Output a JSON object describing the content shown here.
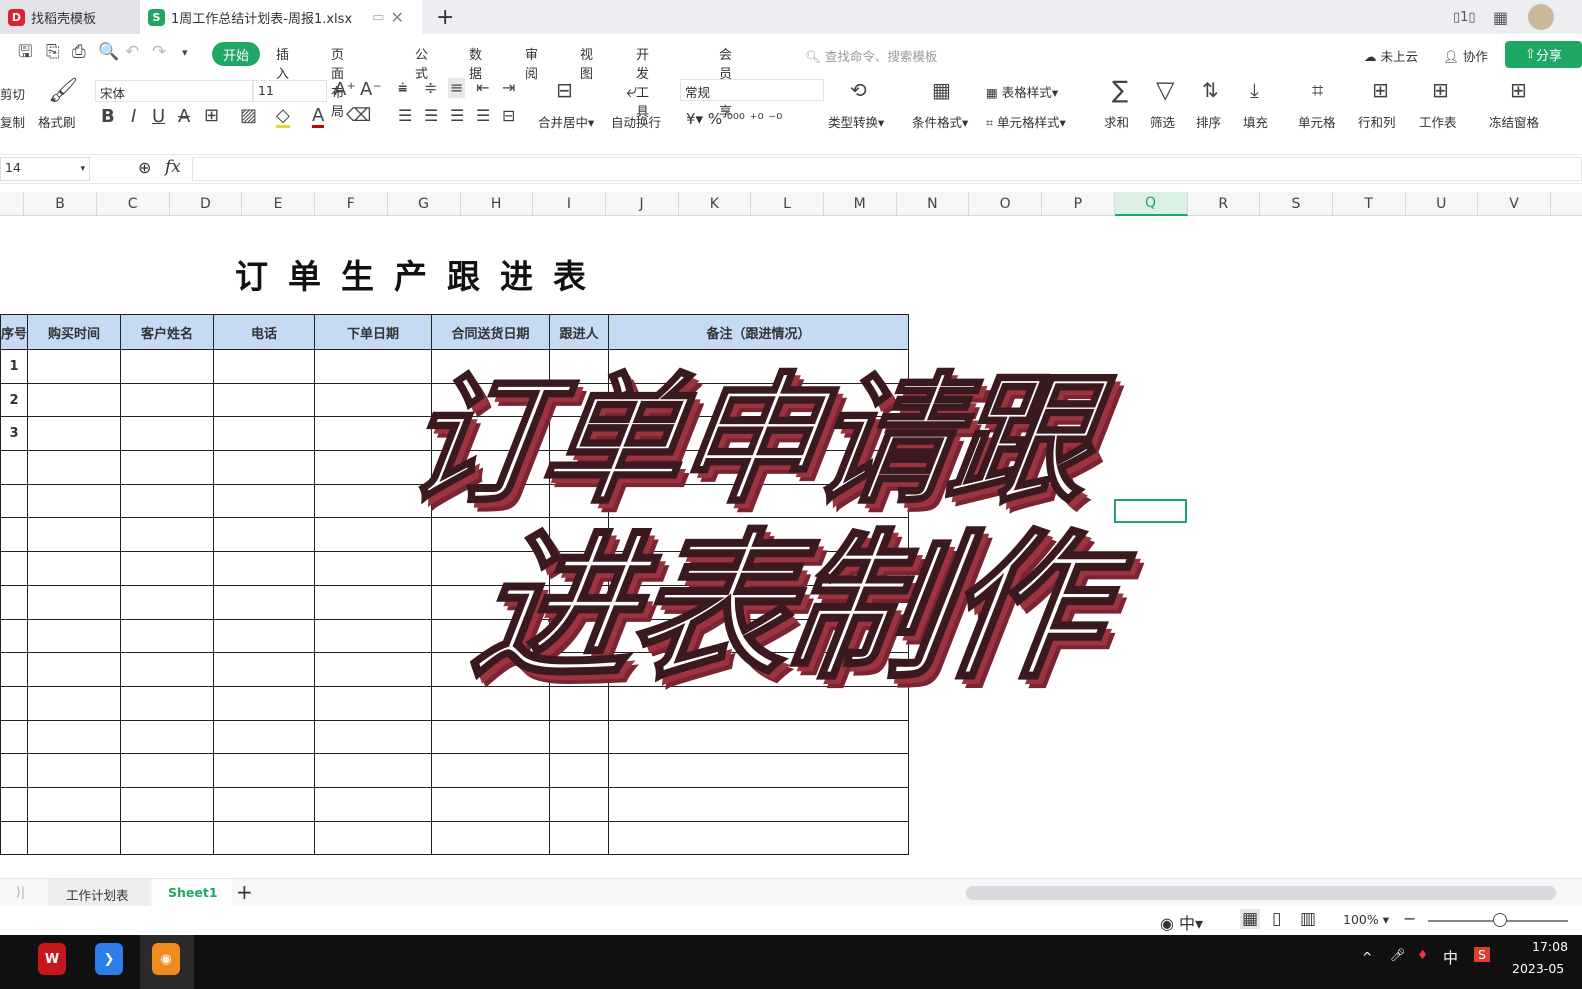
{
  "tabs": [
    {
      "label": "找稻壳模板",
      "icon": "docer-logo-icon",
      "color": "#d9232d"
    },
    {
      "label": "1周工作总结计划表-周报1.xlsx",
      "icon": "spreadsheet-logo-icon",
      "color": "#1fa865"
    }
  ],
  "menu": {
    "items": [
      "插入",
      "页面布局",
      "公式",
      "数据",
      "审阅",
      "视图",
      "开发工具",
      "会员专享"
    ],
    "active": "开始",
    "search_placeholder": "查找命令、搜索模板",
    "cloud": "未上云",
    "collab": "协作",
    "share": "分享"
  },
  "toolbar": {
    "cut": "剪切",
    "copy": "复制",
    "format_painter": "格式刷",
    "font": "宋体",
    "size": "11",
    "number_format": "常规",
    "merge": "合并居中",
    "wrap": "自动换行",
    "convert": "类型转换",
    "cond": "条件格式",
    "table_style": "表格样式",
    "cell_style": "单元格样式",
    "sum": "求和",
    "filter": "筛选",
    "sort": "排序",
    "fill": "填充",
    "cell": "单元格",
    "rowcol": "行和列",
    "sheet": "工作表",
    "freeze": "冻结窗格"
  },
  "formula": {
    "cell_ref": "14",
    "fx": "fx",
    "value": ""
  },
  "columns": [
    "B",
    "C",
    "D",
    "E",
    "F",
    "G",
    "H",
    "I",
    "J",
    "K",
    "L",
    "M",
    "N",
    "O",
    "P",
    "Q",
    "R",
    "S",
    "T",
    "U",
    "V"
  ],
  "selected_column": "Q",
  "sheet": {
    "title": "订单生产跟进表",
    "headers": [
      "序号",
      "购买时间",
      "客户姓名",
      "电话",
      "下单日期",
      "合同送货日期",
      "跟进人",
      "备注（跟进情况）"
    ],
    "rows": [
      [
        "1"
      ],
      [
        "2"
      ],
      [
        "3"
      ],
      [],
      [],
      [],
      [],
      [],
      [],
      [],
      [],
      [],
      [],
      [],
      []
    ]
  },
  "overlay": {
    "line1": "订单申请跟",
    "line2": "进表制作"
  },
  "sheet_tabs": [
    "工作计划表",
    "Sheet1"
  ],
  "active_sheet": "Sheet1",
  "status": {
    "zoom": "100%",
    "zoom_fraction": 0.5
  },
  "taskbar": {
    "ime": "中",
    "time": "17:08",
    "date": "2023-05"
  },
  "colors": {
    "accent": "#1fa865",
    "header_fill": "#c6daf3",
    "overlay_shadow": "#9c3440"
  }
}
